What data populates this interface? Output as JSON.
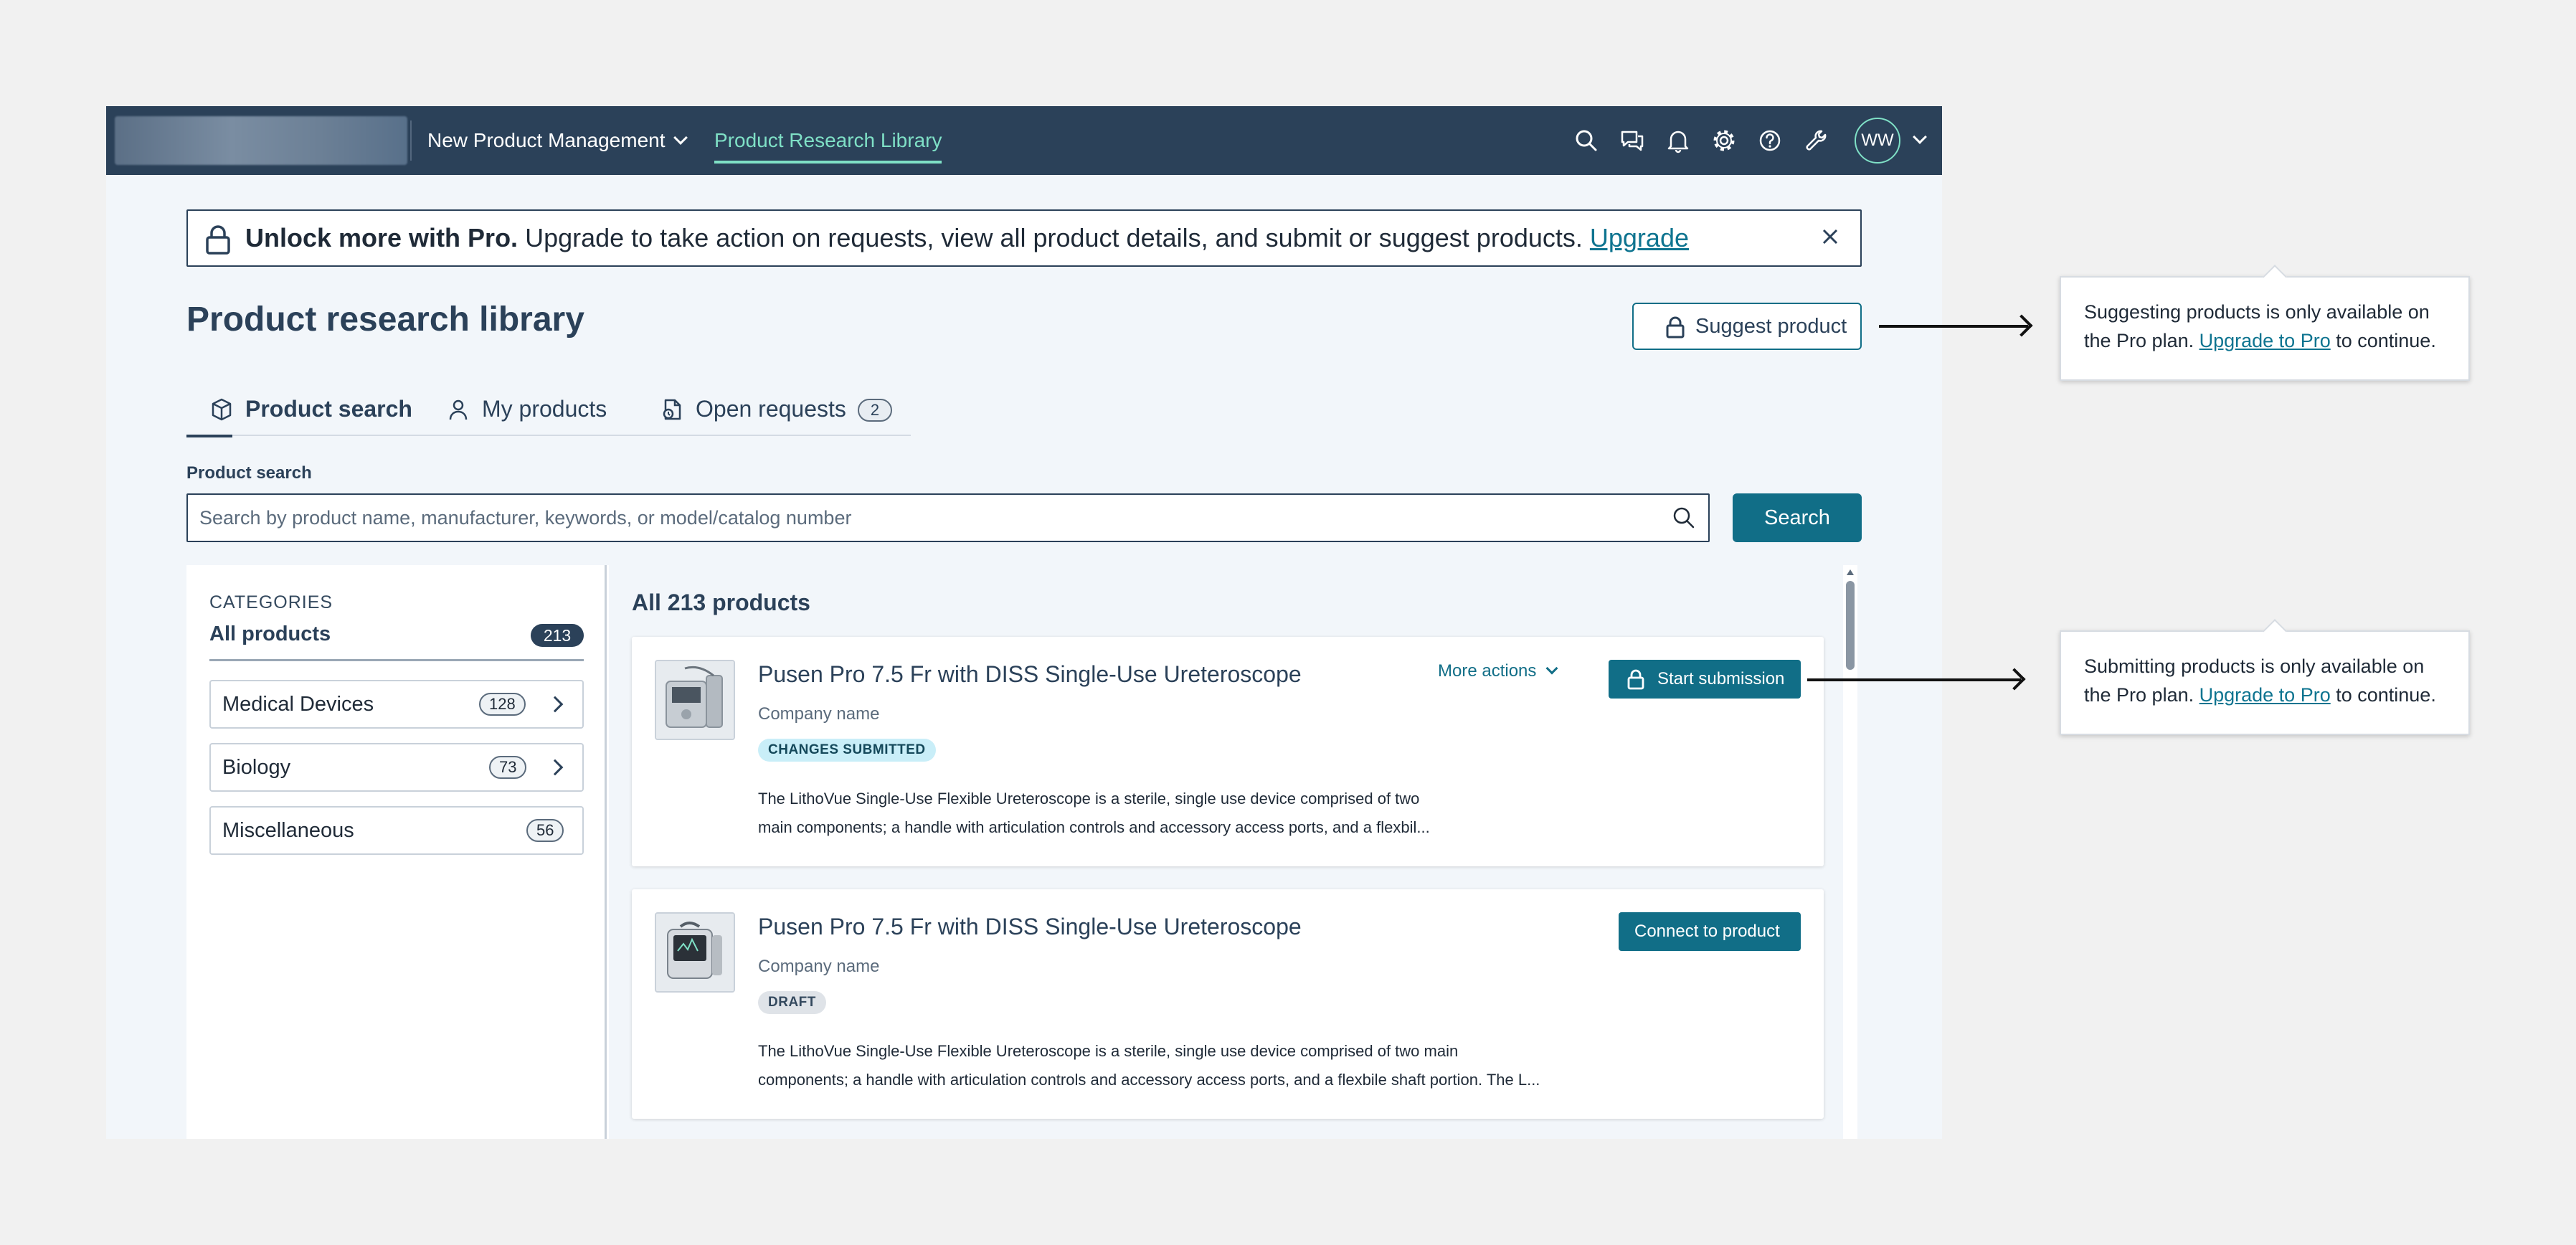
{
  "nav": {
    "product_menu": "New Product Management",
    "active_link": "Product Research Library",
    "avatar_initials": "WW",
    "icons": [
      "search-icon",
      "chat-icon",
      "bell-icon",
      "gear-icon",
      "help-icon",
      "wrench-icon"
    ]
  },
  "promo": {
    "bold": "Unlock more with Pro.",
    "text": " Upgrade to take action on requests, view all product details, and submit or suggest products. ",
    "link": "Upgrade"
  },
  "page": {
    "title": "Product research library",
    "suggest_button": "Suggest product"
  },
  "tabs": [
    {
      "label": "Product search",
      "icon": "cube-icon"
    },
    {
      "label": "My products",
      "icon": "person-icon"
    },
    {
      "label": "Open requests",
      "icon": "requests-icon",
      "count": "2"
    }
  ],
  "search": {
    "label": "Product search",
    "placeholder": "Search by product name, manufacturer, keywords, or model/catalog number",
    "button": "Search"
  },
  "categories": {
    "heading": "CATEGORIES",
    "all_label": "All products",
    "all_count": "213",
    "items": [
      {
        "label": "Medical Devices",
        "count": "128"
      },
      {
        "label": "Biology",
        "count": "73"
      },
      {
        "label": "Miscellaneous",
        "count": "56"
      }
    ]
  },
  "results": {
    "title": "All 213 products",
    "cards": [
      {
        "name": "Pusen Pro 7.5 Fr with DISS Single-Use Ureteroscope",
        "company": "Company name",
        "badge": "CHANGES SUBMITTED",
        "desc_line1": "The LithoVue Single-Use Flexible Ureteroscope is a sterile, single use device comprised of two",
        "desc_line2": "main components; a handle with articulation controls and accessory access ports, and a flexbil...",
        "more_actions": "More actions",
        "action": "Start submission"
      },
      {
        "name": "Pusen Pro 7.5 Fr with DISS Single-Use Ureteroscope",
        "company": "Company name",
        "badge": "DRAFT",
        "desc_line1": "The LithoVue Single-Use Flexible Ureteroscope is a sterile, single use device comprised of two main",
        "desc_line2": "components; a handle with articulation controls and accessory access ports, and a flexbile shaft portion. The L...",
        "action": "Connect to product"
      }
    ]
  },
  "tooltips": [
    {
      "before": "Suggesting products is only available on the Pro plan. ",
      "link": "Upgrade to Pro",
      "after": " to continue."
    },
    {
      "before": "Submitting products is only available on the Pro plan. ",
      "link": "Upgrade to Pro",
      "after": " to continue."
    }
  ],
  "colors": {
    "nav_bg": "#2b4159",
    "accent": "#116e87",
    "active_link": "#7fe0c6",
    "page_bg": "#f2f6fa"
  }
}
